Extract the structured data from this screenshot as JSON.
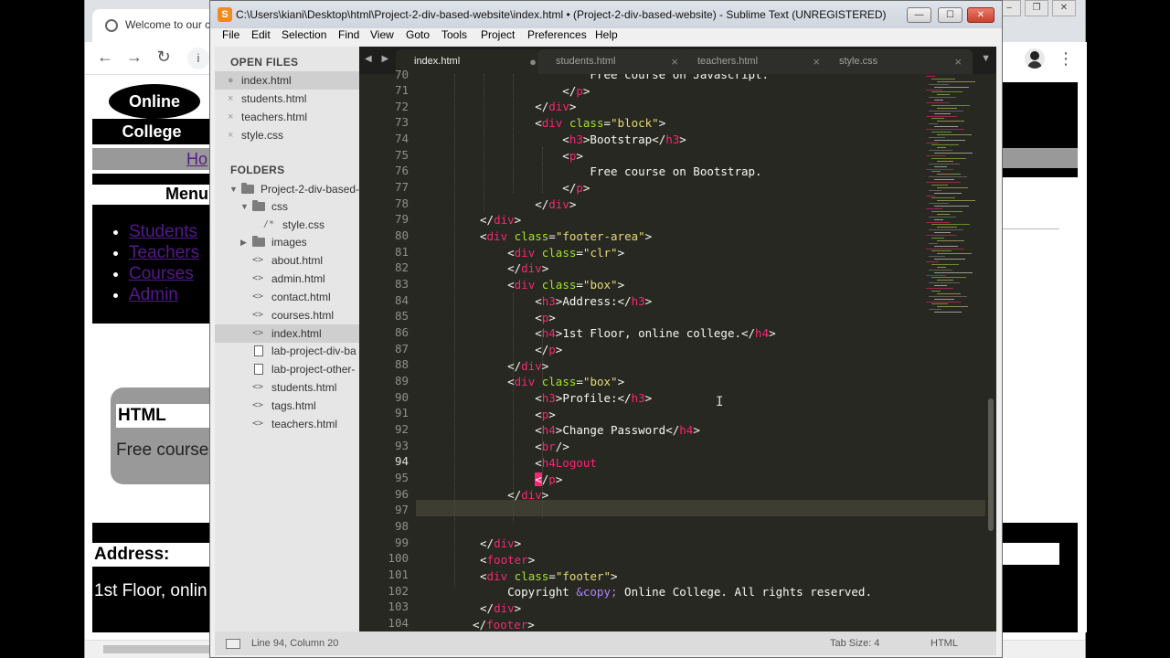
{
  "browser": {
    "tab_title": "Welcome to our c",
    "nav": {
      "back": "←",
      "forward": "→",
      "reload": "↻",
      "info": "i",
      "menu": "⋮"
    },
    "window_buttons": [
      "–",
      "❐",
      "✕"
    ],
    "page": {
      "logo_top": "Online",
      "logo_bottom": "College",
      "home_link": "Ho",
      "menu_title": "Menu",
      "menu_items": [
        "Students",
        "Teachers",
        "Courses",
        "Admin"
      ],
      "block_title": "HTML",
      "block_desc": "Free course",
      "address_title": "Address:",
      "address_text": "1st Floor, onlin"
    }
  },
  "sublime": {
    "app_icon": "S",
    "title": "C:\\Users\\kiani\\Desktop\\html\\Project-2-div-based-website\\index.html • (Project-2-div-based-website) - Sublime Text (UNREGISTERED)",
    "window_buttons": {
      "minimize": "—",
      "maximize": "☐",
      "close": "✕"
    },
    "menu": [
      "File",
      "Edit",
      "Selection",
      "Find",
      "View",
      "Goto",
      "Tools",
      "Project",
      "Preferences",
      "Help"
    ],
    "sidebar": {
      "open_files_heading": "OPEN FILES",
      "open_files": [
        {
          "name": "index.html",
          "marker": "●"
        },
        {
          "name": "students.html",
          "marker": "×"
        },
        {
          "name": "teachers.html",
          "marker": "×"
        },
        {
          "name": "style.css",
          "marker": "×"
        }
      ],
      "folders_heading": "FOLDERS",
      "tree": [
        {
          "name": "Project-2-div-based-",
          "kind": "folder-open",
          "toggle": "▼"
        },
        {
          "name": "css",
          "kind": "folder-open",
          "toggle": "▼"
        },
        {
          "name": "style.css",
          "kind": "css",
          "icon": "/*"
        },
        {
          "name": "images",
          "kind": "folder",
          "toggle": "▶"
        },
        {
          "name": "about.html",
          "kind": "code",
          "icon": "<>"
        },
        {
          "name": "admin.html",
          "kind": "code",
          "icon": "<>"
        },
        {
          "name": "contact.html",
          "kind": "code",
          "icon": "<>"
        },
        {
          "name": "courses.html",
          "kind": "code",
          "icon": "<>"
        },
        {
          "name": "index.html",
          "kind": "code",
          "icon": "<>"
        },
        {
          "name": "lab-project-div-ba",
          "kind": "file"
        },
        {
          "name": "lab-project-other-",
          "kind": "file"
        },
        {
          "name": "students.html",
          "kind": "code",
          "icon": "<>"
        },
        {
          "name": "tags.html",
          "kind": "code",
          "icon": "<>"
        },
        {
          "name": "teachers.html",
          "kind": "code",
          "icon": "<>"
        }
      ]
    },
    "tabs": [
      {
        "label": "index.html",
        "close": "●"
      },
      {
        "label": "students.html",
        "close": "×"
      },
      {
        "label": "teachers.html",
        "close": "×"
      },
      {
        "label": "style.css",
        "close": "×"
      }
    ],
    "tab_arrows": "◀ ▶",
    "tab_dropdown": "▼",
    "line_numbers": [
      "70",
      "71",
      "72",
      "73",
      "74",
      "75",
      "76",
      "77",
      "78",
      "79",
      "80",
      "81",
      "82",
      "83",
      "84",
      "85",
      "86",
      "87",
      "88",
      "89",
      "90",
      "91",
      "92",
      "93",
      "94",
      "95",
      "96",
      "97",
      "98",
      "99",
      "100",
      "101",
      "102",
      "103",
      "104"
    ],
    "status": {
      "position": "Line 94, Column 20",
      "tab_size": "Tab Size: 4",
      "syntax": "HTML"
    }
  }
}
